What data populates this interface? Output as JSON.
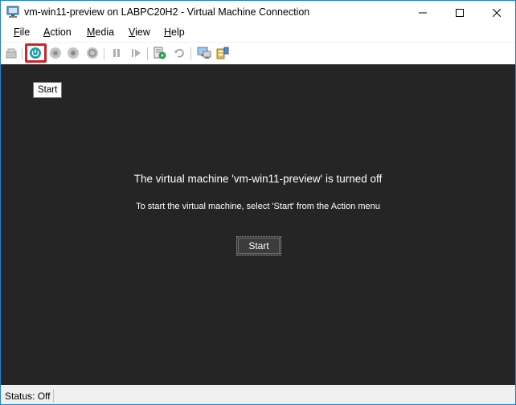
{
  "window": {
    "title": "vm-win11-preview on LABPC20H2 - Virtual Machine Connection"
  },
  "title_controls": {
    "minimize": "minimize-icon",
    "maximize": "maximize-icon",
    "close": "close-icon"
  },
  "menu": {
    "file": {
      "accel": "F",
      "rest": "ile"
    },
    "action": {
      "accel": "A",
      "rest": "ction"
    },
    "media": {
      "accel": "M",
      "rest": "edia"
    },
    "view": {
      "accel": "V",
      "rest": "iew"
    },
    "help": {
      "accel": "H",
      "rest": "elp"
    }
  },
  "toolbar": {
    "icons": [
      "ctrl-alt-del-icon",
      "start-icon",
      "turn-off-icon",
      "shut-down-icon",
      "save-state-icon",
      "pause-icon",
      "resume-icon",
      "checkpoint-icon",
      "revert-icon",
      "enhanced-session-icon",
      "share-icon"
    ],
    "highlight_color": "#d42027",
    "start_icon_color": "#1aa0a0"
  },
  "tooltip": {
    "text": "Start"
  },
  "screen": {
    "title": "The virtual machine 'vm-win11-preview' is turned off",
    "subtitle": "To start the virtual machine, select 'Start' from the Action menu",
    "start_button": "Start",
    "background": "#252525"
  },
  "status": {
    "text": "Status: Off"
  }
}
